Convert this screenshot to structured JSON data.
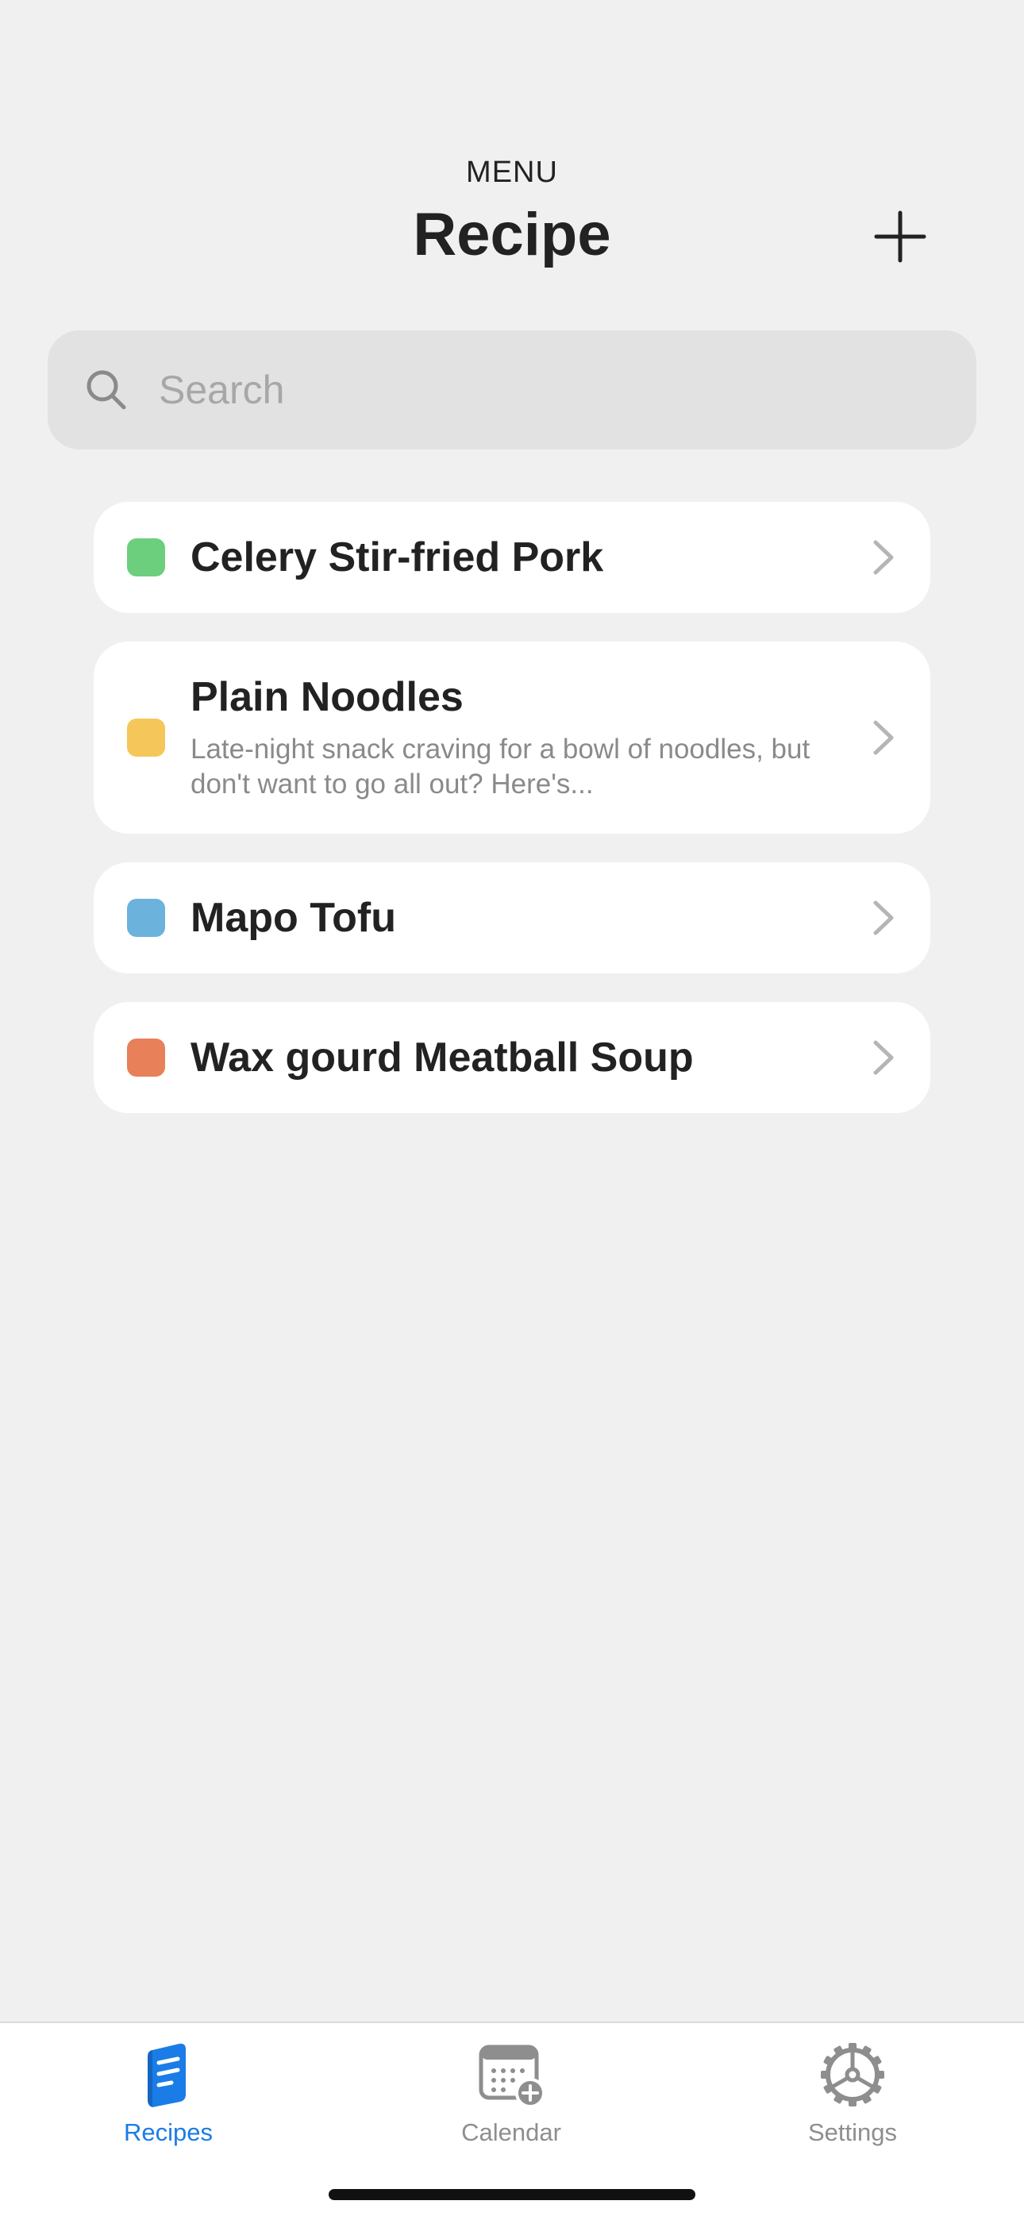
{
  "header": {
    "eyebrow": "MENU",
    "title": "Recipe",
    "add_icon": "plus-icon"
  },
  "search": {
    "placeholder": "Search",
    "value": "",
    "icon": "search-icon"
  },
  "recipes": [
    {
      "title": "Celery Stir-fried Pork",
      "description": "",
      "color": "#6ccf7d"
    },
    {
      "title": "Plain Noodles",
      "description": "Late-night snack craving for a bowl of noodles, but don't want to go all out? Here's...",
      "color": "#f5c75a"
    },
    {
      "title": "Mapo Tofu",
      "description": "",
      "color": "#6bb2dd"
    },
    {
      "title": "Wax gourd Meatball Soup",
      "description": "",
      "color": "#e8805a"
    }
  ],
  "tabs": [
    {
      "label": "Recipes",
      "icon": "book-icon",
      "active": true
    },
    {
      "label": "Calendar",
      "icon": "calendar-add-icon",
      "active": false
    },
    {
      "label": "Settings",
      "icon": "gear-icon",
      "active": false
    }
  ],
  "colors": {
    "accent": "#1a7ce6",
    "inactive": "#8e8e8e",
    "background": "#f0f0f0",
    "card": "#ffffff"
  }
}
